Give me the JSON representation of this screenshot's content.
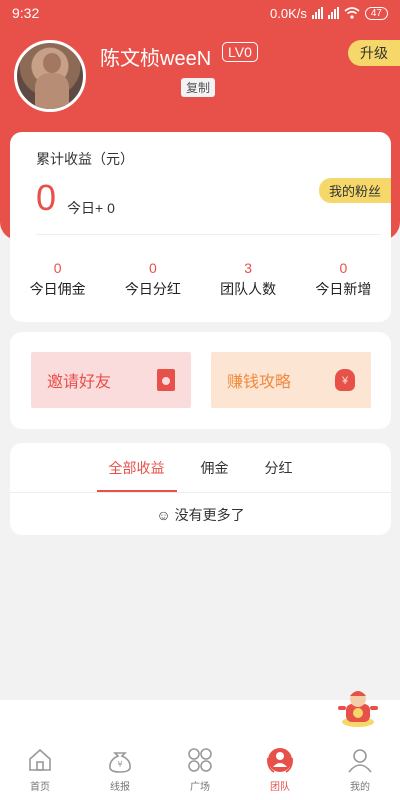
{
  "status": {
    "time": "9:32",
    "network": "0.0K/s",
    "battery": "47"
  },
  "profile": {
    "username": "陈文桢weeN",
    "level": "LV0",
    "copy_label": "复制",
    "upgrade_label": "升级"
  },
  "earnings": {
    "title": "累计收益（元）",
    "total": "0",
    "today_label": "今日+ 0",
    "fans_label": "我的粉丝",
    "stats": [
      {
        "value": "0",
        "label": "今日佣金"
      },
      {
        "value": "0",
        "label": "今日分红"
      },
      {
        "value": "3",
        "label": "团队人数"
      },
      {
        "value": "0",
        "label": "今日新增"
      }
    ]
  },
  "actions": {
    "invite_label": "邀请好友",
    "strategy_label": "赚钱攻略"
  },
  "tabs": [
    {
      "label": "全部收益",
      "active": true
    },
    {
      "label": "佣金",
      "active": false
    },
    {
      "label": "分红",
      "active": false
    }
  ],
  "empty_text": "☺ 没有更多了",
  "nav": [
    {
      "label": "首页",
      "icon": "home-icon"
    },
    {
      "label": "线报",
      "icon": "money-bag-icon"
    },
    {
      "label": "广场",
      "icon": "grid-circles-icon"
    },
    {
      "label": "团队",
      "icon": "team-icon",
      "active": true
    },
    {
      "label": "我的",
      "icon": "user-icon"
    }
  ],
  "colors": {
    "primary": "#e8504a",
    "gold": "#f6d86a",
    "invite_bg": "#fadcdc",
    "strategy_bg": "#fde5d4",
    "strategy_text": "#ef8a3c"
  }
}
